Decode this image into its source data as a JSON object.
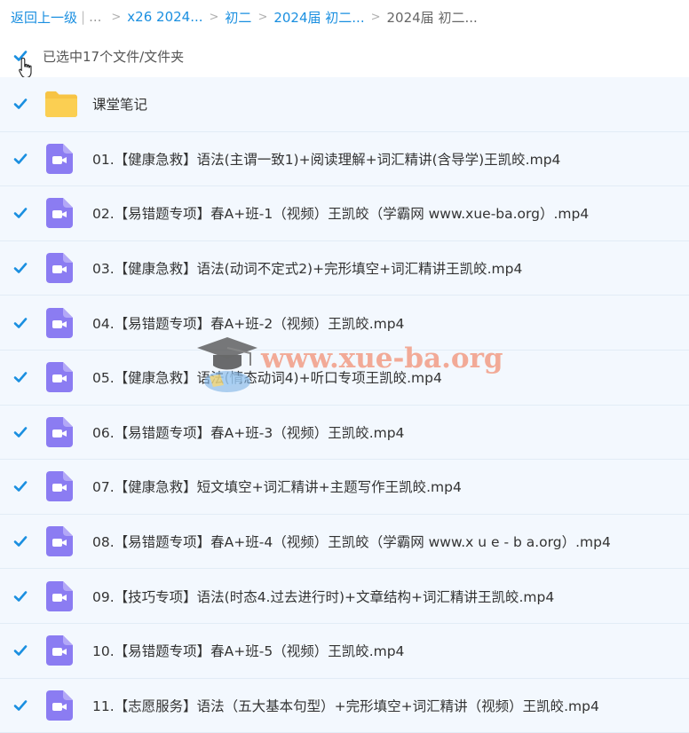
{
  "breadcrumb": {
    "back": "返回上一级",
    "ellipsis": "...",
    "sep": ">",
    "items": [
      "x26 2024...",
      "初二",
      "2024届 初二..."
    ],
    "current": "2024届 初二..."
  },
  "selection": {
    "text": "已选中17个文件/文件夹",
    "all_checked": true
  },
  "accent_color": "#1a8fe0",
  "icons": {
    "checkbox": "checkbox-checked-icon",
    "folder": "folder-icon",
    "video": "video-file-icon",
    "cursor": "hand-pointer-icon"
  },
  "files": [
    {
      "name": "课堂笔记",
      "type": "folder",
      "checked": true
    },
    {
      "name": "01.【健康急救】语法(主谓一致1)+阅读理解+词汇精讲(含导学)王凯皎.mp4",
      "type": "video",
      "checked": true
    },
    {
      "name": "02.【易错题专项】春A+班-1（视频）王凯皎（学霸网 www.xue-ba.org）.mp4",
      "type": "video",
      "checked": true
    },
    {
      "name": "03.【健康急救】语法(动词不定式2)+完形填空+词汇精讲王凯皎.mp4",
      "type": "video",
      "checked": true
    },
    {
      "name": "04.【易错题专项】春A+班-2（视频）王凯皎.mp4",
      "type": "video",
      "checked": true
    },
    {
      "name": "05.【健康急救】语法(情态动词4)+听口专项王凯皎.mp4",
      "type": "video",
      "checked": true
    },
    {
      "name": "06.【易错题专项】春A+班-3（视频）王凯皎.mp4",
      "type": "video",
      "checked": true
    },
    {
      "name": "07.【健康急救】短文填空+词汇精讲+主题写作王凯皎.mp4",
      "type": "video",
      "checked": true
    },
    {
      "name": "08.【易错题专项】春A+班-4（视频）王凯皎（学霸网 www.x u e - b a.org）.mp4",
      "type": "video",
      "checked": true
    },
    {
      "name": "09.【技巧专项】语法(时态4.过去进行时)+文章结构+词汇精讲王凯皎.mp4",
      "type": "video",
      "checked": true
    },
    {
      "name": "10.【易错题专项】春A+班-5（视频）王凯皎.mp4",
      "type": "video",
      "checked": true
    },
    {
      "name": "11.【志愿服务】语法（五大基本句型）+完形填空+词汇精讲（视频）王凯皎.mp4",
      "type": "video",
      "checked": true
    }
  ],
  "watermark": {
    "text": "www.xue-ba.org"
  }
}
